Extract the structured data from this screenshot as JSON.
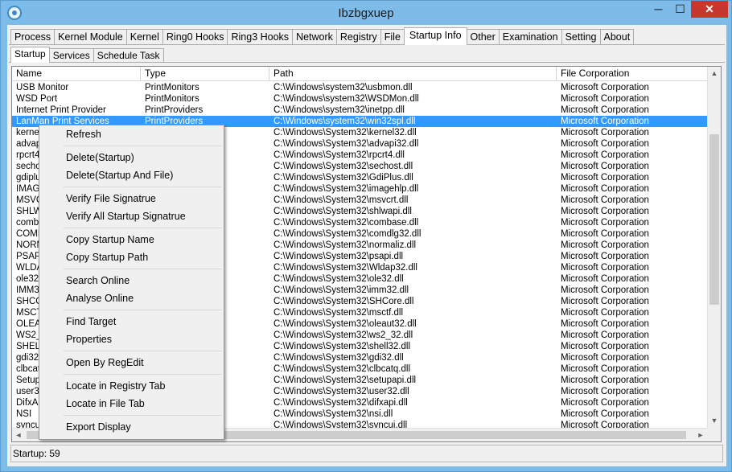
{
  "window": {
    "title": "Ibzbgxuep",
    "minimize": "─",
    "maximize": "☐",
    "close": "✕"
  },
  "tabs": [
    "Process",
    "Kernel Module",
    "Kernel",
    "Ring0 Hooks",
    "Ring3 Hooks",
    "Network",
    "Registry",
    "File",
    "Startup Info",
    "Other",
    "Examination",
    "Setting",
    "About"
  ],
  "active_tab": "Startup Info",
  "subtabs": [
    "Startup",
    "Services",
    "Schedule Task"
  ],
  "active_subtab": "Startup",
  "columns": [
    "Name",
    "Type",
    "Path",
    "File Corporation"
  ],
  "rows": [
    [
      "USB Monitor",
      "PrintMonitors",
      "C:\\Windows\\system32\\usbmon.dll",
      "Microsoft Corporation"
    ],
    [
      "WSD Port",
      "PrintMonitors",
      "C:\\Windows\\system32\\WSDMon.dll",
      "Microsoft Corporation"
    ],
    [
      "Internet Print Provider",
      "PrintProviders",
      "C:\\Windows\\system32\\inetpp.dll",
      "Microsoft Corporation"
    ],
    [
      "LanMan Print Services",
      "PrintProviders",
      "C:\\Windows\\system32\\win32spl.dll",
      "Microsoft Corporation"
    ],
    [
      "kernel",
      "",
      "C:\\Windows\\System32\\kernel32.dll",
      "Microsoft Corporation"
    ],
    [
      "advap",
      "",
      "C:\\Windows\\System32\\advapi32.dll",
      "Microsoft Corporation"
    ],
    [
      "rpcrt4",
      "",
      "C:\\Windows\\System32\\rpcrt4.dll",
      "Microsoft Corporation"
    ],
    [
      "secho",
      "",
      "C:\\Windows\\System32\\sechost.dll",
      "Microsoft Corporation"
    ],
    [
      "gdiplu",
      "",
      "C:\\Windows\\System32\\GdiPlus.dll",
      "Microsoft Corporation"
    ],
    [
      "IMAG",
      "",
      "C:\\Windows\\System32\\imagehlp.dll",
      "Microsoft Corporation"
    ],
    [
      "MSVC",
      "",
      "C:\\Windows\\System32\\msvcrt.dll",
      "Microsoft Corporation"
    ],
    [
      "SHLW",
      "",
      "C:\\Windows\\System32\\shlwapi.dll",
      "Microsoft Corporation"
    ],
    [
      "comba",
      "",
      "C:\\Windows\\System32\\combase.dll",
      "Microsoft Corporation"
    ],
    [
      "COMD",
      "",
      "C:\\Windows\\System32\\comdlg32.dll",
      "Microsoft Corporation"
    ],
    [
      "NORM",
      "",
      "C:\\Windows\\System32\\normaliz.dll",
      "Microsoft Corporation"
    ],
    [
      "PSAP",
      "",
      "C:\\Windows\\System32\\psapi.dll",
      "Microsoft Corporation"
    ],
    [
      "WLDA",
      "",
      "C:\\Windows\\System32\\Wldap32.dll",
      "Microsoft Corporation"
    ],
    [
      "ole32",
      "",
      "C:\\Windows\\System32\\ole32.dll",
      "Microsoft Corporation"
    ],
    [
      "IMM32",
      "",
      "C:\\Windows\\System32\\imm32.dll",
      "Microsoft Corporation"
    ],
    [
      "SHCO",
      "",
      "C:\\Windows\\System32\\SHCore.dll",
      "Microsoft Corporation"
    ],
    [
      "MSCT",
      "",
      "C:\\Windows\\System32\\msctf.dll",
      "Microsoft Corporation"
    ],
    [
      "OLEA",
      "",
      "C:\\Windows\\System32\\oleaut32.dll",
      "Microsoft Corporation"
    ],
    [
      "WS2_",
      "",
      "C:\\Windows\\System32\\ws2_32.dll",
      "Microsoft Corporation"
    ],
    [
      "SHELL",
      "",
      "C:\\Windows\\System32\\shell32.dll",
      "Microsoft Corporation"
    ],
    [
      "gdi32",
      "",
      "C:\\Windows\\System32\\gdi32.dll",
      "Microsoft Corporation"
    ],
    [
      "clbcat",
      "",
      "C:\\Windows\\System32\\clbcatq.dll",
      "Microsoft Corporation"
    ],
    [
      "Setup",
      "",
      "C:\\Windows\\System32\\setupapi.dll",
      "Microsoft Corporation"
    ],
    [
      "user3",
      "",
      "C:\\Windows\\System32\\user32.dll",
      "Microsoft Corporation"
    ],
    [
      "DifxA",
      "",
      "C:\\Windows\\System32\\difxapi.dll",
      "Microsoft Corporation"
    ],
    [
      "NSI",
      "",
      "C:\\Windows\\System32\\nsi.dll",
      "Microsoft Corporation"
    ],
    [
      "syncu",
      "",
      "C:\\Windows\\System32\\syncui.dll",
      "Microsoft Corporation"
    ]
  ],
  "selected_row": 3,
  "context_menu": [
    [
      "Refresh"
    ],
    [
      "Delete(Startup)",
      "Delete(Startup And File)"
    ],
    [
      "Verify File Signatrue",
      "Verify All Startup Signatrue"
    ],
    [
      "Copy Startup Name",
      "Copy Startup Path"
    ],
    [
      "Search Online",
      "Analyse Online"
    ],
    [
      "Find Target",
      "Properties"
    ],
    [
      "Open By RegEdit"
    ],
    [
      "Locate in Registry Tab",
      "Locate in File Tab"
    ],
    [
      "Export Display"
    ]
  ],
  "status": {
    "text": "Startup: 59"
  },
  "scroll": {
    "up": "▲",
    "down": "▼",
    "left": "◄",
    "right": "►"
  }
}
